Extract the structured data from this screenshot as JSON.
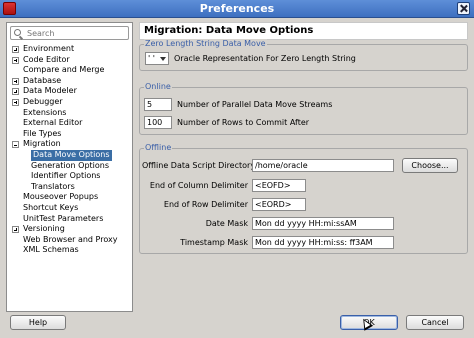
{
  "window": {
    "title": "Preferences"
  },
  "search": {
    "placeholder": "Search"
  },
  "tree": [
    {
      "label": "Environment",
      "expander": "plus"
    },
    {
      "label": "Code Editor",
      "expander": "plus"
    },
    {
      "label": "Compare and Merge",
      "expander": ""
    },
    {
      "label": "Database",
      "expander": "plus"
    },
    {
      "label": "Data Modeler",
      "expander": "plus"
    },
    {
      "label": "Debugger",
      "expander": "plus"
    },
    {
      "label": "Extensions",
      "expander": ""
    },
    {
      "label": "External Editor",
      "expander": ""
    },
    {
      "label": "File Types",
      "expander": ""
    },
    {
      "label": "Migration",
      "expander": "minus"
    },
    {
      "label": "Data Move Options",
      "expander": "",
      "child": true,
      "selected": true
    },
    {
      "label": "Generation Options",
      "expander": "",
      "child": true
    },
    {
      "label": "Identifier Options",
      "expander": "",
      "child": true
    },
    {
      "label": "Translators",
      "expander": "",
      "child": true
    },
    {
      "label": "Mouseover Popups",
      "expander": ""
    },
    {
      "label": "Shortcut Keys",
      "expander": ""
    },
    {
      "label": "UnitTest Parameters",
      "expander": ""
    },
    {
      "label": "Versioning",
      "expander": "plus"
    },
    {
      "label": "Web Browser and Proxy",
      "expander": ""
    },
    {
      "label": "XML Schemas",
      "expander": ""
    }
  ],
  "main": {
    "title": "Migration: Data Move Options",
    "zero_length": {
      "group_label": "Zero Length String Data Move",
      "combo_value": "' '",
      "label": "Oracle Representation For Zero Length String"
    },
    "online": {
      "group_label": "Online",
      "streams_value": "5",
      "streams_label": "Number of Parallel Data Move Streams",
      "rows_value": "100",
      "rows_label": "Number of Rows to Commit After"
    },
    "offline": {
      "group_label": "Offline",
      "script_dir_label": "Offline Data Script Directory",
      "script_dir_value": "/home/oracle",
      "choose_label": "Choose...",
      "col_delim_label": "End of Column Delimiter",
      "col_delim_value": "<EOFD>",
      "row_delim_label": "End of Row Delimiter",
      "row_delim_value": "<EORD>",
      "date_mask_label": "Date Mask",
      "date_mask_value": "Mon dd yyyy HH:mi:ssAM",
      "ts_mask_label": "Timestamp Mask",
      "ts_mask_value": "Mon dd yyyy HH:mi:ss: ff3AM"
    }
  },
  "footer": {
    "help_label": "Help",
    "ok_label": "OK",
    "cancel_label": "Cancel"
  },
  "colors": {
    "titlebar": "#3d6fc0",
    "selection": "#3a6ea5",
    "group_label": "#3a5fa8"
  }
}
